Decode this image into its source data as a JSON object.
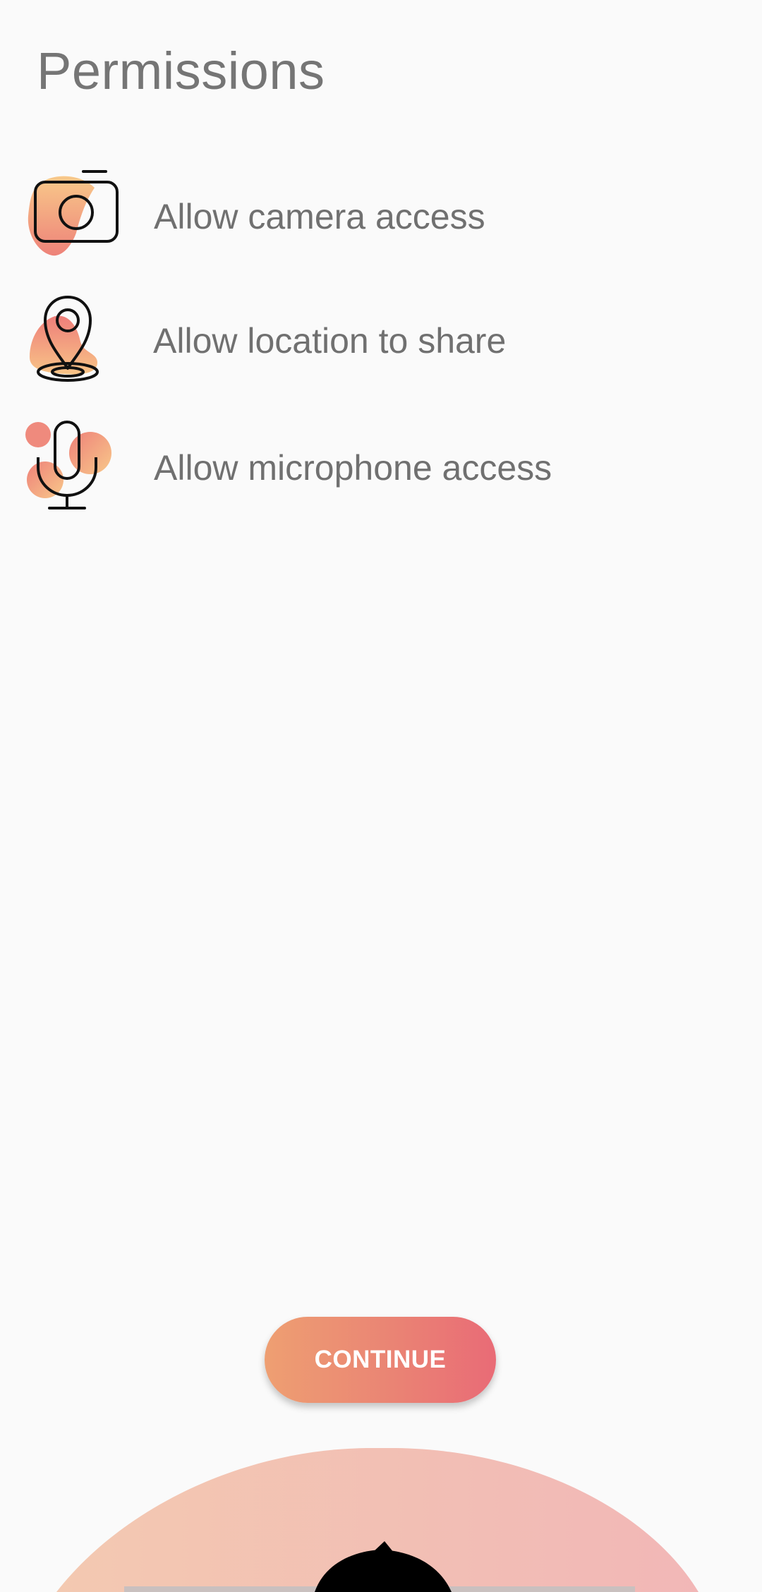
{
  "header": {
    "title": "Permissions"
  },
  "permissions": [
    {
      "label": "Allow camera access",
      "icon": "camera-icon"
    },
    {
      "label": "Allow location to share",
      "icon": "location-pin-icon"
    },
    {
      "label": "Allow microphone access",
      "icon": "microphone-icon"
    }
  ],
  "actions": {
    "continue_label": "CONTINUE"
  },
  "colors": {
    "accent_orange": "#ee9f72",
    "accent_pink": "#e96b76",
    "text_gray": "#757575",
    "background": "#fafafa"
  }
}
